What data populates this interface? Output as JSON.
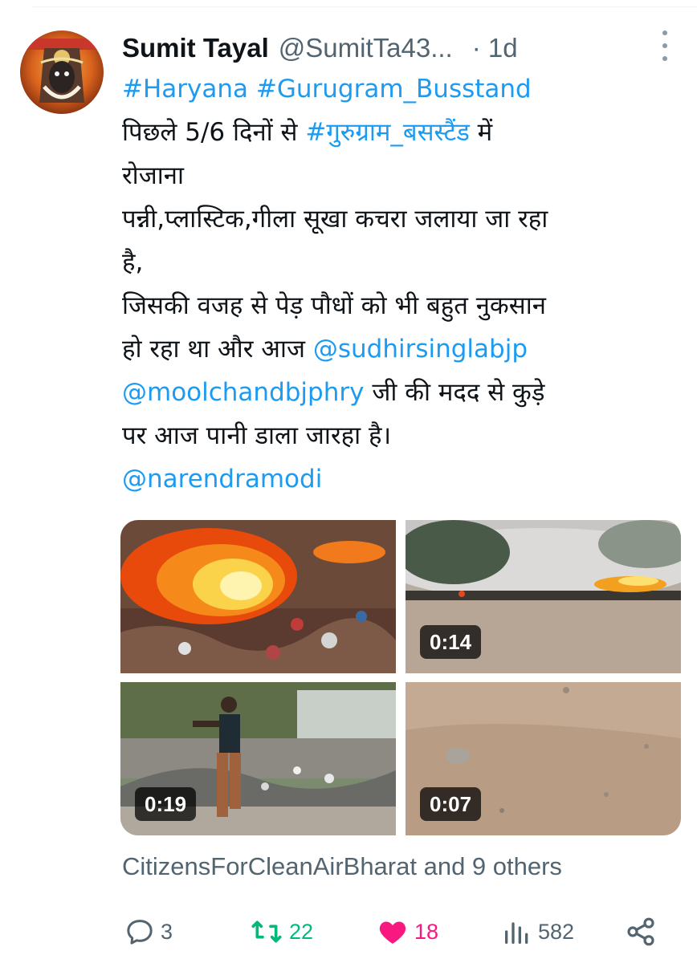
{
  "tweet": {
    "author_name": "Sumit Tayal",
    "author_handle": "@SumitTa43...",
    "time_separator": "·",
    "time": "1d",
    "text_lines": [
      {
        "parts": [
          {
            "text": "#Haryana",
            "link": true
          },
          {
            "text": " ",
            "link": false
          },
          {
            "text": "#Gurugram_Busstand",
            "link": true
          }
        ]
      },
      {
        "parts": [
          {
            "text": "पिछले 5/6 दिनों से ",
            "link": false
          },
          {
            "text": "#गुरुग्राम_बसस्टैंड",
            "link": true
          },
          {
            "text": " में",
            "link": false
          }
        ]
      },
      {
        "parts": [
          {
            "text": "रोजाना",
            "link": false
          }
        ]
      },
      {
        "parts": [
          {
            "text": "पन्नी,प्लास्टिक,गीला सूखा कचरा जलाया जा रहा",
            "link": false
          }
        ]
      },
      {
        "parts": [
          {
            "text": "है,",
            "link": false
          }
        ]
      },
      {
        "parts": [
          {
            "text": "जिसकी वजह से पेड़ पौधों को भी बहुत नुकसान",
            "link": false
          }
        ]
      },
      {
        "parts": [
          {
            "text": "हो रहा था और आज ",
            "link": false
          },
          {
            "text": "@sudhirsinglabjp",
            "link": true
          }
        ]
      },
      {
        "parts": [
          {
            "text": "@moolchandbjphry",
            "link": true
          },
          {
            "text": " जी की मदद से कुड़े",
            "link": false
          }
        ]
      },
      {
        "parts": [
          {
            "text": "पर आज पानी डाला जारहा है।",
            "link": false
          }
        ]
      },
      {
        "parts": [
          {
            "text": "@narendramodi",
            "link": true
          }
        ]
      }
    ],
    "media": [
      {
        "kind": "fire-closeup",
        "duration": ""
      },
      {
        "kind": "smoke-field",
        "duration": "0:14"
      },
      {
        "kind": "man-walking",
        "duration": "0:19"
      },
      {
        "kind": "dirt-ground",
        "duration": "0:07"
      }
    ],
    "reposted_by": "CitizensForCleanAirBharat and 9 others",
    "stats": {
      "replies": "3",
      "retweets": "22",
      "likes": "18",
      "views": "582"
    },
    "colors": {
      "link": "#1d9bf0",
      "retweet": "#00ba7c",
      "like": "#f91880",
      "muted": "#536471"
    },
    "icons": [
      "more-icon",
      "reply-icon",
      "retweet-icon",
      "like-icon",
      "views-icon",
      "share-icon"
    ]
  }
}
